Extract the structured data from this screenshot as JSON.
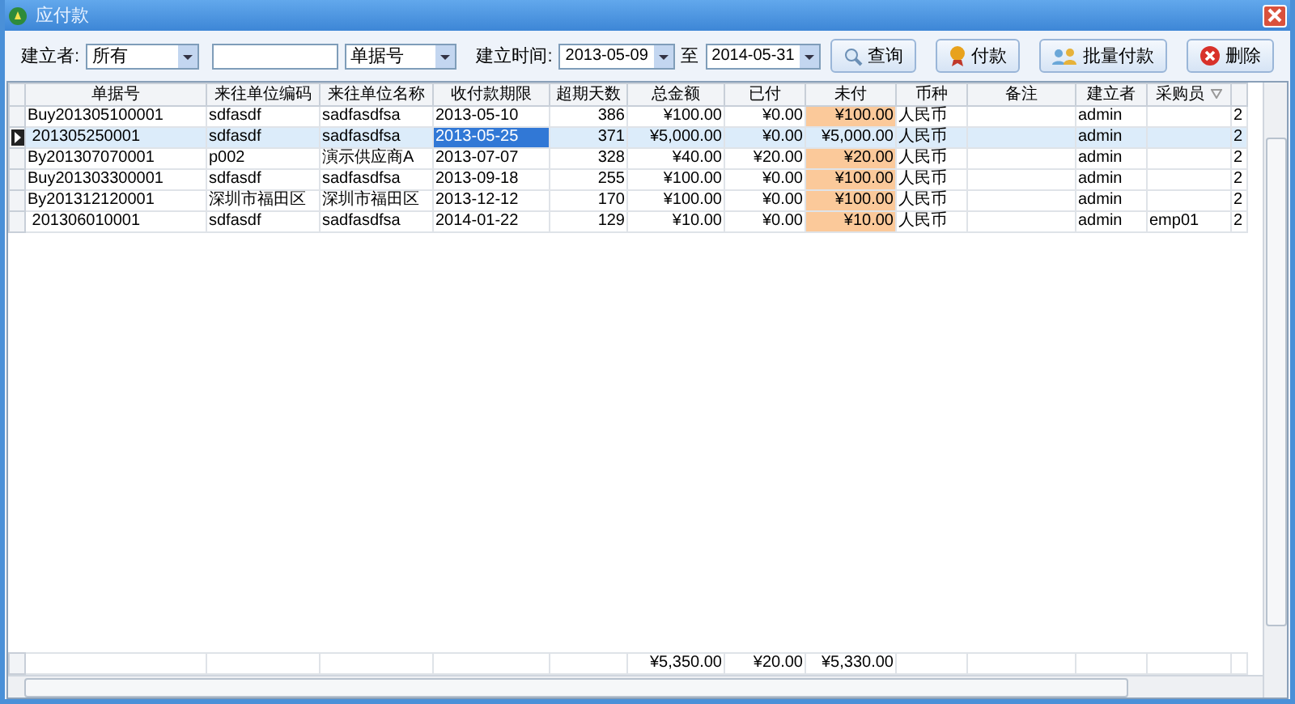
{
  "window": {
    "title": "应付款"
  },
  "filters": {
    "creator_label": "建立者:",
    "creator_value": "所有",
    "field_value": "单据号",
    "date_label": "建立时间:",
    "date_from": "2013-05-09",
    "date_sep": "至",
    "date_to": "2014-05-31"
  },
  "buttons": [
    {
      "kind": "search",
      "label": "查询"
    },
    {
      "kind": "pay",
      "label": "付款"
    },
    {
      "kind": "batch",
      "label": "批量付款"
    },
    {
      "kind": "delete",
      "label": "删除"
    }
  ],
  "table": {
    "columns": [
      {
        "label": "单据号",
        "filter": false
      },
      {
        "label": "来往单位编码",
        "filter": false
      },
      {
        "label": "来往单位名称",
        "filter": false
      },
      {
        "label": "收付款期限",
        "filter": false
      },
      {
        "label": "超期天数",
        "filter": false
      },
      {
        "label": "总金额",
        "filter": false
      },
      {
        "label": "已付",
        "filter": false
      },
      {
        "label": "未付",
        "filter": false
      },
      {
        "label": "币种",
        "filter": false
      },
      {
        "label": "备注",
        "filter": false
      },
      {
        "label": "建立者",
        "filter": false
      },
      {
        "label": "采购员",
        "filter": true
      },
      {
        "filter": false
      }
    ],
    "rows": [
      {
        "selected": false,
        "unpaid_highlighted": true,
        "focused_date": false,
        "cells": [
          "Buy201305100001",
          "sdfasdf",
          "sadfasdfsa",
          "2013-05-10",
          "386",
          "¥100.00",
          "¥0.00",
          "¥100.00",
          "人民币",
          "",
          "admin",
          "",
          "2"
        ]
      },
      {
        "selected": true,
        "unpaid_highlighted": false,
        "focused_date": true,
        "cells": [
          " 201305250001",
          "sdfasdf",
          "sadfasdfsa",
          "2013-05-25",
          "371",
          "¥5,000.00",
          "¥0.00",
          "¥5,000.00",
          "人民币",
          "",
          "admin",
          "",
          "2"
        ]
      },
      {
        "selected": false,
        "unpaid_highlighted": true,
        "focused_date": false,
        "cells": [
          "By201307070001",
          "p002",
          "演示供应商A",
          "2013-07-07",
          "328",
          "¥40.00",
          "¥20.00",
          "¥20.00",
          "人民币",
          "",
          "admin",
          "",
          "2"
        ]
      },
      {
        "selected": false,
        "unpaid_highlighted": true,
        "focused_date": false,
        "cells": [
          "Buy201303300001",
          "sdfasdf",
          "sadfasdfsa",
          "2013-09-18",
          "255",
          "¥100.00",
          "¥0.00",
          "¥100.00",
          "人民币",
          "",
          "admin",
          "",
          "2"
        ]
      },
      {
        "selected": false,
        "unpaid_highlighted": true,
        "focused_date": false,
        "cells": [
          "By201312120001",
          "深圳市福田区",
          "深圳市福田区",
          "2013-12-12",
          "170",
          "¥100.00",
          "¥0.00",
          "¥100.00",
          "人民币",
          "",
          "admin",
          "",
          "2"
        ]
      },
      {
        "selected": false,
        "unpaid_highlighted": true,
        "focused_date": false,
        "cells": [
          " 201306010001",
          "sdfasdf",
          "sadfasdfsa",
          "2014-01-22",
          "129",
          "¥10.00",
          "¥0.00",
          "¥10.00",
          "人民币",
          "",
          "admin",
          "emp01",
          "2"
        ]
      }
    ],
    "totals": {
      "total_amount": "¥5,350.00",
      "paid": "¥20.00",
      "unpaid": "¥5,330.00"
    }
  }
}
